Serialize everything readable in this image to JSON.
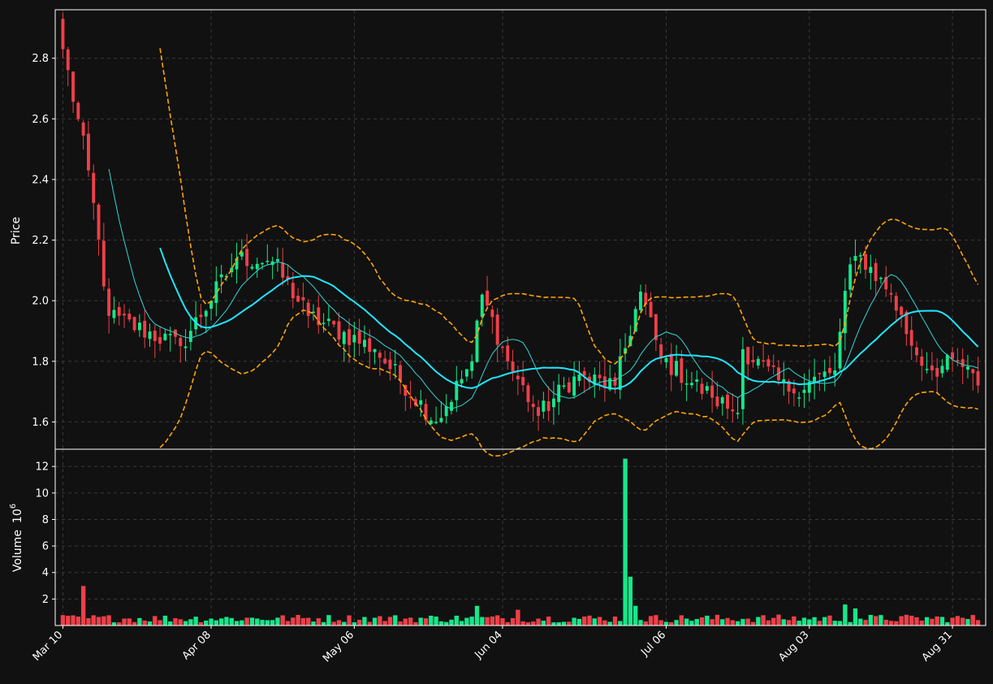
{
  "chart_data": {
    "type": "candlestick",
    "colors": {
      "background": "#111111",
      "up": "#14e88a",
      "down": "#ef3f49",
      "grid": "#3a3a3a",
      "frame": "#ffffff",
      "text": "#ffffff",
      "ma_fast": "#33d6d6",
      "ma_slow": "#1fe6ff",
      "bands": "#ffa500"
    },
    "price_panel": {
      "ylabel": "Price",
      "ylim": [
        1.51,
        2.96
      ],
      "yticks": [
        1.6,
        1.8,
        2.0,
        2.2,
        2.4,
        2.6,
        2.8
      ],
      "ytick_labels": [
        "1.6",
        "1.8",
        "2.0",
        "2.2",
        "2.4",
        "2.6",
        "2.8"
      ]
    },
    "volume_panel": {
      "ylabel": "Volume",
      "ylabel_exponent": "10",
      "ylabel_power": "6",
      "ylim": [
        0,
        13.3
      ],
      "yticks": [
        2,
        4,
        6,
        8,
        10,
        12
      ],
      "ytick_labels": [
        "2",
        "4",
        "6",
        "8",
        "10",
        "12"
      ]
    },
    "x_ticks": [
      {
        "label": "Mar 10",
        "date": "2025-03-10"
      },
      {
        "label": "Apr 08",
        "date": "2025-04-08"
      },
      {
        "label": "May 06",
        "date": "2025-05-06"
      },
      {
        "label": "Jun 04",
        "date": "2025-06-04"
      },
      {
        "label": "Jul 06",
        "date": "2025-07-06"
      },
      {
        "label": "Aug 03",
        "date": "2025-08-03"
      },
      {
        "label": "Aug 31",
        "date": "2025-08-31"
      }
    ],
    "x_range": [
      "2025-03-09",
      "2025-09-06"
    ],
    "key_points": [
      {
        "date": "2025-03-10",
        "close": 2.83
      },
      {
        "date": "2025-03-15",
        "close": 2.43
      },
      {
        "date": "2025-03-19",
        "close": 1.95
      },
      {
        "date": "2025-04-02",
        "close": 1.85
      },
      {
        "date": "2025-04-13",
        "close": 2.14
      },
      {
        "date": "2025-04-20",
        "close": 2.13
      },
      {
        "date": "2025-04-27",
        "close": 1.95
      },
      {
        "date": "2025-05-10",
        "close": 1.84
      },
      {
        "date": "2025-05-22",
        "close": 1.6
      },
      {
        "date": "2025-05-29",
        "close": 1.8
      },
      {
        "date": "2025-05-31",
        "close": 2.02
      },
      {
        "date": "2025-06-05",
        "close": 1.8
      },
      {
        "date": "2025-06-11",
        "close": 1.62
      },
      {
        "date": "2025-06-18",
        "close": 1.75
      },
      {
        "date": "2025-06-26",
        "close": 1.72
      },
      {
        "date": "2025-07-01",
        "close": 2.03
      },
      {
        "date": "2025-07-05",
        "close": 1.81
      },
      {
        "date": "2025-07-15",
        "close": 1.68
      },
      {
        "date": "2025-07-20",
        "close": 1.63
      },
      {
        "date": "2025-07-21",
        "close": 1.84
      },
      {
        "date": "2025-07-30",
        "close": 1.7
      },
      {
        "date": "2025-08-08",
        "close": 1.77
      },
      {
        "date": "2025-08-11",
        "close": 2.12
      },
      {
        "date": "2025-08-13",
        "close": 2.15
      },
      {
        "date": "2025-08-19",
        "close": 2.02
      },
      {
        "date": "2025-08-24",
        "close": 1.82
      },
      {
        "date": "2025-08-27",
        "close": 1.77
      },
      {
        "date": "2025-09-01",
        "close": 1.8
      },
      {
        "date": "2025-09-05",
        "close": 1.72
      }
    ],
    "volume_spikes": [
      {
        "date": "2025-03-14",
        "value": 3.0
      },
      {
        "date": "2025-06-28",
        "value": 12.6
      },
      {
        "date": "2025-06-29",
        "value": 3.7
      },
      {
        "date": "2025-06-30",
        "value": 1.5
      },
      {
        "date": "2025-05-30",
        "value": 1.5
      },
      {
        "date": "2025-08-10",
        "value": 1.6
      },
      {
        "date": "2025-08-12",
        "value": 1.3
      },
      {
        "date": "2025-06-07",
        "value": 1.2
      }
    ]
  }
}
